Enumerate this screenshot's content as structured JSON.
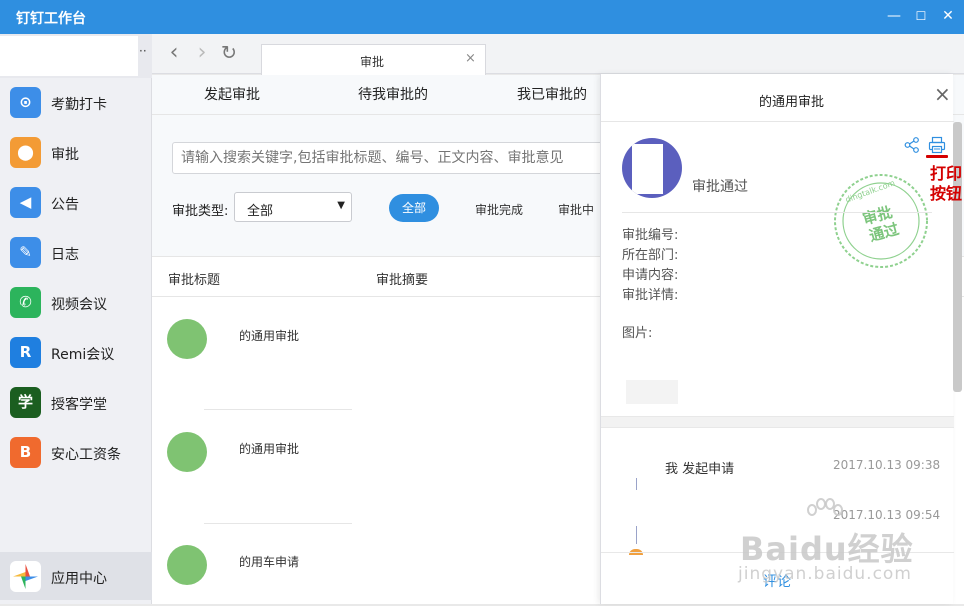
{
  "window": {
    "title": "钉钉工作台",
    "min_glyph": "—",
    "max_glyph": "☐",
    "close_glyph": "✕"
  },
  "sidebar": {
    "more_glyph": "··",
    "items": [
      {
        "label": "考勤打卡",
        "icon": "location-pin-icon",
        "color": "#3d8ee8",
        "glyph": "⊙"
      },
      {
        "label": "审批",
        "icon": "approval-person-icon",
        "color": "#f39b35",
        "glyph": "⬤"
      },
      {
        "label": "公告",
        "icon": "megaphone-icon",
        "color": "#3d8ee8",
        "glyph": "◀"
      },
      {
        "label": "日志",
        "icon": "notebook-icon",
        "color": "#3d8ee8",
        "glyph": "✎"
      },
      {
        "label": "视频会议",
        "icon": "video-phone-icon",
        "color": "#2cb45c",
        "glyph": "✆"
      },
      {
        "label": "Remi会议",
        "icon": "remi-logo-icon",
        "color": "#1f7fe0",
        "glyph": "R"
      },
      {
        "label": "授客学堂",
        "icon": "xue-character-icon",
        "color": "#1b5e20",
        "glyph": "学"
      },
      {
        "label": "安心工资条",
        "icon": "salary-slip-icon",
        "color": "#f06a2e",
        "glyph": "B"
      }
    ],
    "bottom_item": {
      "label": "应用中心",
      "icon": "app-center-icon"
    }
  },
  "browser": {
    "back_glyph": "‹",
    "forward_glyph": "›",
    "refresh_glyph": "↻",
    "tab_label": "审批",
    "tab_close": "×"
  },
  "main": {
    "subtabs": [
      "发起审批",
      "待我审批的",
      "我已审批的"
    ],
    "search_placeholder": "请输入搜索关键字,包括审批标题、编号、正文内容、审批意见",
    "type_label": "审批类型:",
    "type_value": "全部",
    "type_arrow": "▼",
    "filters": [
      "全部",
      "审批完成",
      "审批中"
    ],
    "columns": [
      "审批标题",
      "审批摘要"
    ],
    "rows": [
      {
        "title": "的通用审批"
      },
      {
        "title": "的通用审批"
      },
      {
        "title": "的用车申请"
      }
    ]
  },
  "detail": {
    "title": "的通用审批",
    "close_glyph": "×",
    "status": "审批通过",
    "stamp_text": "审批\n通过",
    "stamp_url": "dingtalk.com",
    "fields": [
      "审批编号:",
      "所在部门:",
      "申请内容:",
      "审批详情:",
      "图片:"
    ],
    "flow": [
      {
        "text": "我 发起申请",
        "time": "2017.10.13 09:38"
      },
      {
        "text": "",
        "time": "2017.10.13 09:54"
      }
    ],
    "comment_label": "评论"
  },
  "annotation": {
    "line1": "打印",
    "line2": "按钮",
    "color": "#d40000"
  },
  "watermark": {
    "brand": "Baidu经验",
    "url": "jingyan.baidu.com"
  }
}
